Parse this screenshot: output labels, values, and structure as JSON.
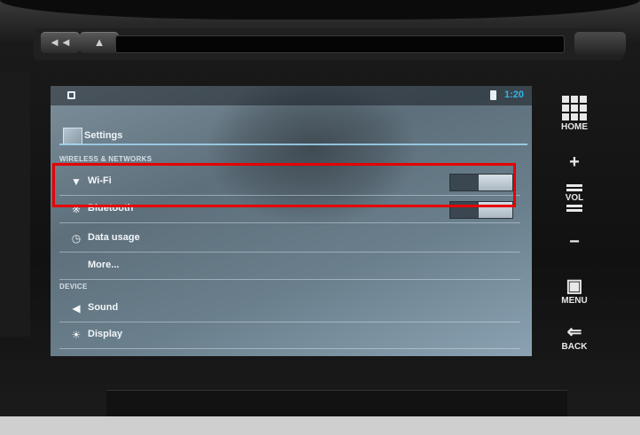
{
  "statusbar": {
    "clock": "1:20"
  },
  "actionbar": {
    "title": "Settings"
  },
  "sections": {
    "wireless": "Wireless & networks",
    "device": "Device"
  },
  "rows": [
    {
      "label": "Wi-Fi",
      "icon": "wifi-icon",
      "toggle": true
    },
    {
      "label": "Bluetooth",
      "icon": "bluetooth-icon",
      "toggle": true
    },
    {
      "label": "Data usage",
      "icon": "data-usage-icon",
      "toggle": false
    },
    {
      "label": "More...",
      "icon": "",
      "toggle": false
    },
    {
      "label": "Sound",
      "icon": "speaker-icon",
      "toggle": false
    },
    {
      "label": "Display",
      "icon": "display-icon",
      "toggle": false
    }
  ],
  "side_buttons": {
    "home": "HOME",
    "vol": "VOL",
    "menu": "MENU",
    "back": "BACK"
  },
  "colors": {
    "highlight": "#e60000",
    "accent": "#33b5e5"
  }
}
